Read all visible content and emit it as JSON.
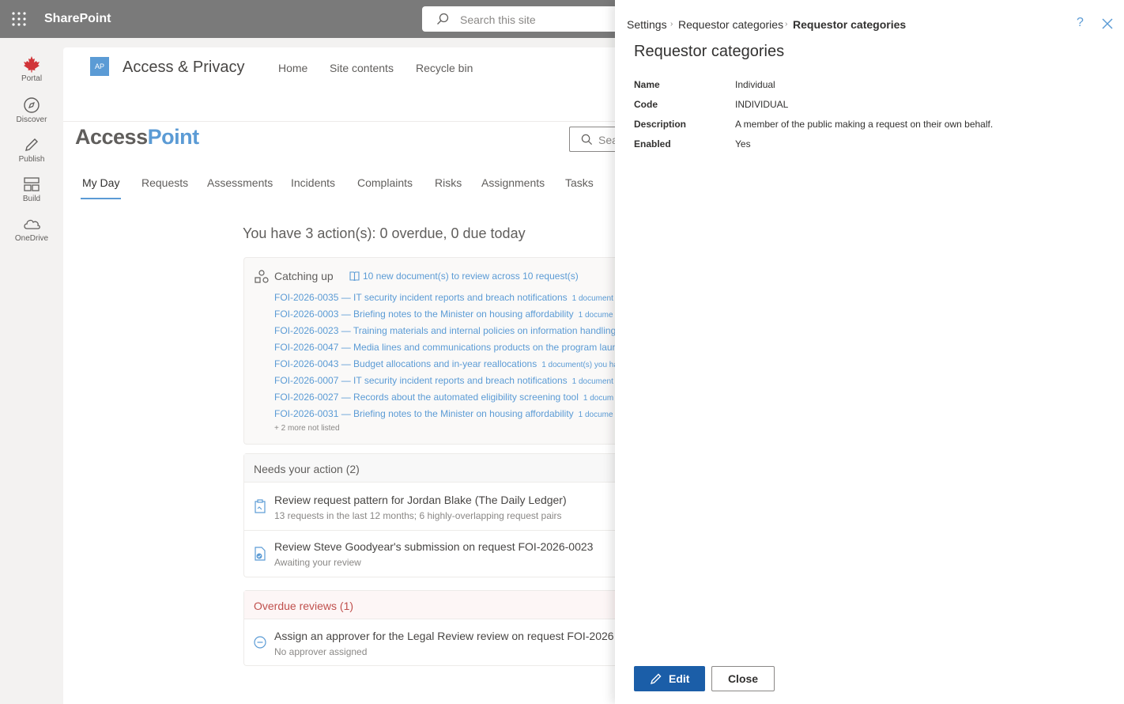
{
  "suite": {
    "brand": "SharePoint",
    "search_placeholder": "Search this site"
  },
  "appbar": [
    {
      "label": "Portal",
      "icon": "maple-leaf-icon"
    },
    {
      "label": "Discover",
      "icon": "compass-icon"
    },
    {
      "label": "Publish",
      "icon": "pen-icon"
    },
    {
      "label": "Build",
      "icon": "layout-icon"
    },
    {
      "label": "OneDrive",
      "icon": "cloud-icon"
    }
  ],
  "site": {
    "logo": "AP",
    "title": "Access & Privacy",
    "nav": [
      "Home",
      "Site contents",
      "Recycle bin"
    ]
  },
  "app": {
    "logo_part1": "Access",
    "logo_part2": "Point",
    "search_placeholder": "Sea",
    "tabs": [
      "My Day",
      "Requests",
      "Assessments",
      "Incidents",
      "Complaints",
      "Risks",
      "Assignments",
      "Tasks"
    ],
    "headline": "You have 3 action(s): 0 overdue, 0 due today"
  },
  "catching_up": {
    "title": "Catching up",
    "link": "10 new document(s) to review across 10 request(s)",
    "requests": [
      {
        "text": "FOI-2026-0035 — IT security incident reports and breach notifications",
        "meta": "1 document"
      },
      {
        "text": "FOI-2026-0003 — Briefing notes to the Minister on housing affordability",
        "meta": "1 docume"
      },
      {
        "text": "FOI-2026-0023 — Training materials and internal policies on information handling",
        "meta": ""
      },
      {
        "text": "FOI-2026-0047 — Media lines and communications products on the program laun",
        "meta": ""
      },
      {
        "text": "FOI-2026-0043 — Budget allocations and in-year reallocations",
        "meta": "1 document(s) you ha"
      },
      {
        "text": "FOI-2026-0007 — IT security incident reports and breach notifications",
        "meta": "1 document"
      },
      {
        "text": "FOI-2026-0027 — Records about the automated eligibility screening tool",
        "meta": "1 docum"
      },
      {
        "text": "FOI-2026-0031 — Briefing notes to the Minister on housing affordability",
        "meta": "1 docume"
      }
    ],
    "more": "+ 2 more not listed"
  },
  "needs_action": {
    "title": "Needs your action (2)",
    "items": [
      {
        "title": "Review request pattern for Jordan Blake (The Daily Ledger)",
        "sub": "13 requests in the last 12 months; 6 highly-overlapping request pairs"
      },
      {
        "title": "Review Steve Goodyear's submission on request FOI-2026-0023",
        "sub": "Awaiting your review"
      }
    ]
  },
  "overdue": {
    "title": "Overdue reviews (1)",
    "items": [
      {
        "title": "Assign an approver for the Legal Review review on request FOI-2026",
        "sub": "No approver assigned"
      }
    ]
  },
  "panel": {
    "breadcrumb": [
      "Settings",
      "Requestor categories",
      "Requestor categories"
    ],
    "title": "Requestor categories",
    "fields": [
      {
        "label": "Name",
        "value": "Individual"
      },
      {
        "label": "Code",
        "value": "INDIVIDUAL"
      },
      {
        "label": "Description",
        "value": "A member of the public making a request on their own behalf."
      },
      {
        "label": "Enabled",
        "value": "Yes"
      }
    ],
    "edit_label": "Edit",
    "close_label": "Close",
    "help_glyph": "?"
  },
  "colors": {
    "accent": "#5b9bd5",
    "primary_button": "#1b5ea8",
    "overdue": "#c0504d",
    "suitebar": "#7a7a7a"
  }
}
